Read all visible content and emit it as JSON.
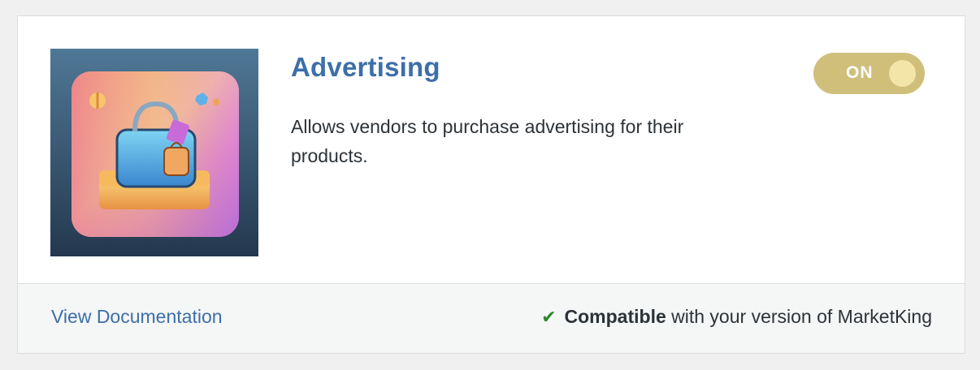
{
  "module": {
    "title": "Advertising",
    "description": "Allows vendors to purchase advertising for their products.",
    "image_icon": "shopping-bag-icon",
    "toggle": {
      "label": "ON",
      "state": "on",
      "color": "#cfbf7a"
    }
  },
  "footer": {
    "doc_link": "View Documentation",
    "compat_icon": "check-icon",
    "compat_strong": "Compatible",
    "compat_rest": " with your version of MarketKing"
  },
  "colors": {
    "title": "#3d6fa8",
    "link": "#3d6fa8",
    "check": "#2e8a2e"
  }
}
